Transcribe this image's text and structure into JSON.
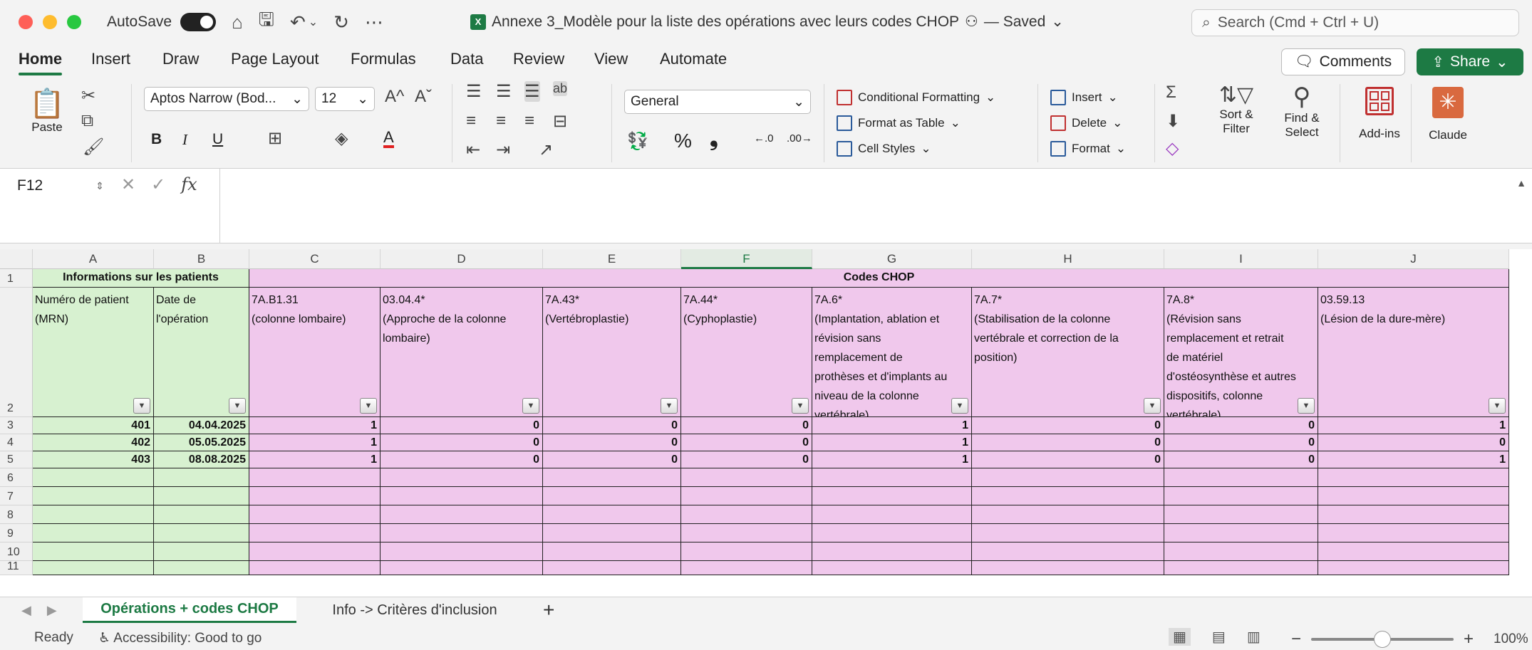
{
  "window": {
    "autosave_label": "AutoSave",
    "document_title": "Annexe 3_Modèle pour la liste des opérations avec leurs codes CHOP",
    "saved_status": "— Saved",
    "search_placeholder": "Search (Cmd + Ctrl + U)"
  },
  "menu": {
    "tabs": [
      {
        "label": "Home",
        "active": true
      },
      {
        "label": "Insert"
      },
      {
        "label": "Draw"
      },
      {
        "label": "Page Layout"
      },
      {
        "label": "Formulas"
      },
      {
        "label": "Data"
      },
      {
        "label": "Review"
      },
      {
        "label": "View"
      },
      {
        "label": "Automate"
      }
    ],
    "comments_label": "Comments",
    "share_label": "Share"
  },
  "ribbon": {
    "paste_label": "Paste",
    "font_name": "Aptos Narrow (Bod...",
    "font_size": "12",
    "bold": "B",
    "italic": "I",
    "underline": "U",
    "number_format": "General",
    "percent": "%",
    "comma": "❟",
    "conditional_formatting": "Conditional Formatting",
    "format_as_table": "Format as Table",
    "cell_styles": "Cell Styles",
    "insert": "Insert",
    "delete": "Delete",
    "format": "Format",
    "sort_filter_1": "Sort &",
    "sort_filter_2": "Filter",
    "find_select_1": "Find &",
    "find_select_2": "Select",
    "addins": "Add-ins",
    "claude": "Claude"
  },
  "formula_bar": {
    "name_box": "F12",
    "fx": "fx",
    "value": ""
  },
  "sheet": {
    "columns": [
      "A",
      "B",
      "C",
      "D",
      "E",
      "F",
      "G",
      "H",
      "I",
      "J"
    ],
    "selected_column": "F",
    "row_numbers": [
      "1",
      "2",
      "3",
      "4",
      "5",
      "6",
      "7",
      "8",
      "9",
      "10",
      "11"
    ],
    "row1": {
      "patients_group": "Informations sur les patients",
      "codes_group": "Codes CHOP"
    },
    "headers": [
      "Numéro de patient\n(MRN)",
      "Date de\nl'opération",
      "7A.B1.31\n(colonne lombaire)",
      "03.04.4*\n(Approche de la colonne\nlombaire)",
      "7A.43*\n(Vertébroplastie)",
      "7A.44*\n(Cyphoplastie)",
      "7A.6*\n(Implantation, ablation et\nrévision sans\nremplacement de\nprothèses et d'implants au\nniveau de la colonne\nvertébrale)",
      "7A.7*\n(Stabilisation de la colonne\nvertébrale et correction de la\nposition)",
      "7A.8*\n(Révision sans\nremplacement et retrait\nde matériel\nd'ostéosynthèse et autres\ndispositifs, colonne\nvertébrale)",
      "03.59.13\n(Lésion de la dure-mère)"
    ],
    "rows": [
      [
        "401",
        "04.04.2025",
        "1",
        "0",
        "0",
        "0",
        "1",
        "0",
        "0",
        "1"
      ],
      [
        "402",
        "05.05.2025",
        "1",
        "0",
        "0",
        "0",
        "1",
        "0",
        "0",
        "0"
      ],
      [
        "403",
        "08.08.2025",
        "1",
        "0",
        "0",
        "0",
        "1",
        "0",
        "0",
        "1"
      ]
    ]
  },
  "sheet_tabs": {
    "tabs": [
      {
        "label": "Opérations + codes CHOP",
        "active": true
      },
      {
        "label": "Info -> Critères d'inclusion"
      }
    ],
    "add": "+"
  },
  "status": {
    "ready": "Ready",
    "accessibility": "Accessibility: Good to go",
    "zoom": "100%",
    "zoom_level": 0.5
  },
  "colors": {
    "accent": "#1d7a44",
    "green_fill": "#d7f1d0",
    "pink_fill": "#f0c8ec"
  }
}
